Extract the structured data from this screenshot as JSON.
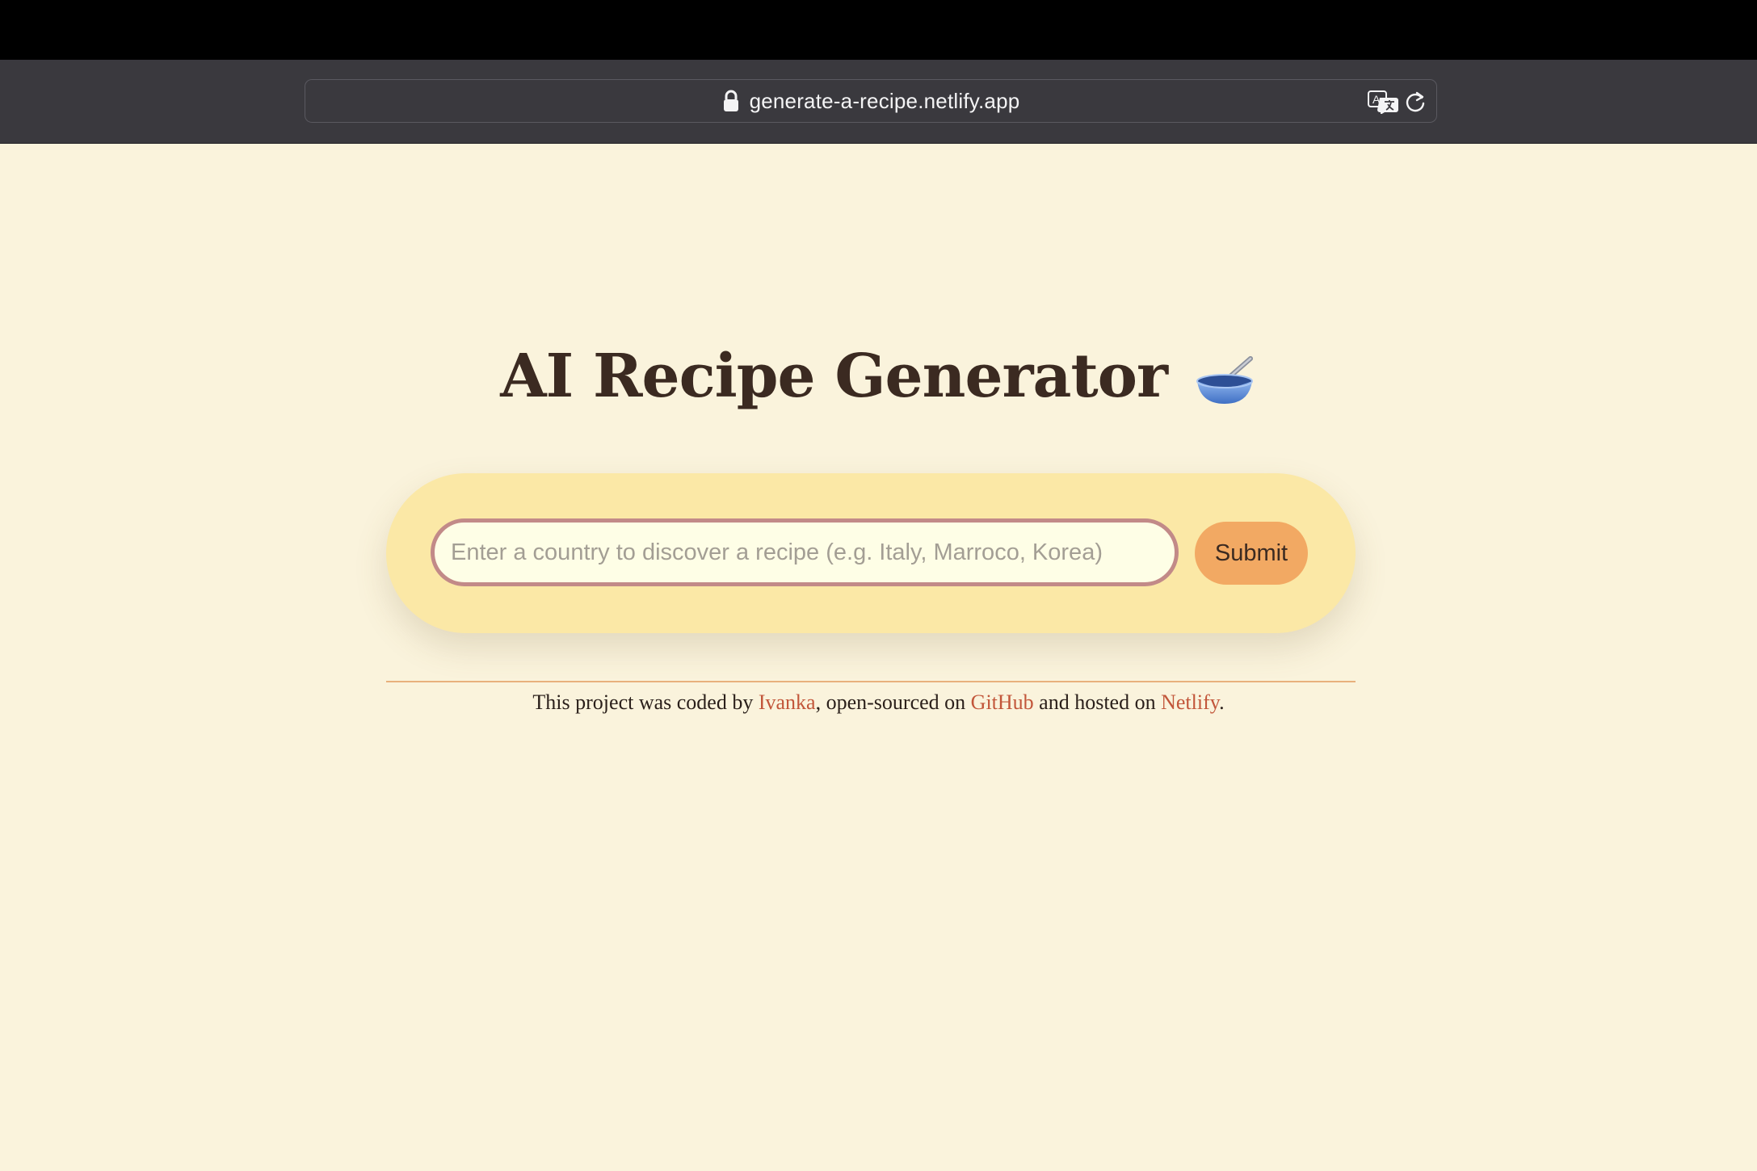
{
  "browser": {
    "url": "generate-a-recipe.netlify.app",
    "lock_icon": "lock-icon",
    "translate_icon": "translate-icon",
    "reload_icon": "reload-icon"
  },
  "main": {
    "title": "AI Recipe Generator",
    "title_icon": "bowl-with-spoon-icon",
    "search": {
      "placeholder": "Enter a country to discover a recipe (e.g. Italy, Marroco, Korea)",
      "value": ""
    },
    "submit_label": "Submit"
  },
  "footer": {
    "text_1": "This project was coded by ",
    "link_author": "Ivanka",
    "text_2": ", open-sourced on ",
    "link_github": "GitHub",
    "text_3": " and hosted on ",
    "link_netlify": "Netlify",
    "text_4": "."
  },
  "colors": {
    "page_background": "#faf3dc",
    "title": "#3b2a21",
    "form_background": "#fbe8a6",
    "input_border": "#c28a88",
    "button": "#f2a963",
    "link": "#c2563a",
    "divider": "#e8b07c"
  }
}
